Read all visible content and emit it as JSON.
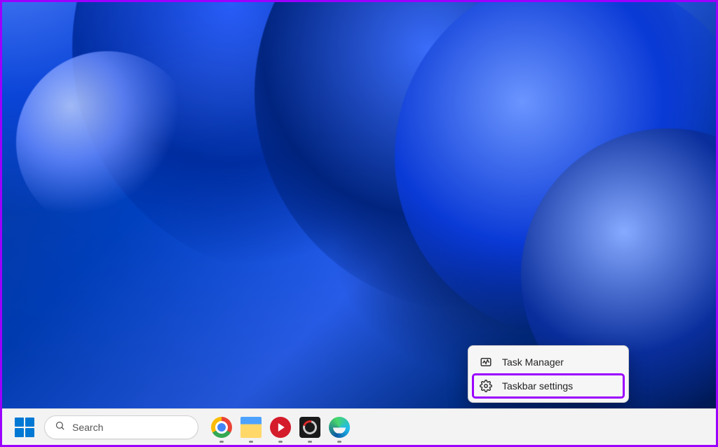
{
  "context_menu": {
    "items": [
      {
        "id": "task-manager",
        "label": "Task Manager",
        "icon": "activity-icon",
        "highlighted": false
      },
      {
        "id": "taskbar-settings",
        "label": "Taskbar settings",
        "icon": "gear-icon",
        "highlighted": true
      }
    ]
  },
  "taskbar": {
    "search_placeholder": "Search",
    "start_tooltip": "Start",
    "pinned_apps": [
      {
        "id": "chrome",
        "name": "Google Chrome",
        "running": true
      },
      {
        "id": "file-explorer",
        "name": "File Explorer",
        "running": true
      },
      {
        "id": "screen-recorder",
        "name": "Screen Recorder",
        "running": true
      },
      {
        "id": "obs",
        "name": "OBS Studio",
        "running": true
      },
      {
        "id": "edge",
        "name": "Microsoft Edge",
        "running": true
      }
    ]
  },
  "colors": {
    "accent": "#0078d4",
    "annotation": "#9b00ff"
  }
}
